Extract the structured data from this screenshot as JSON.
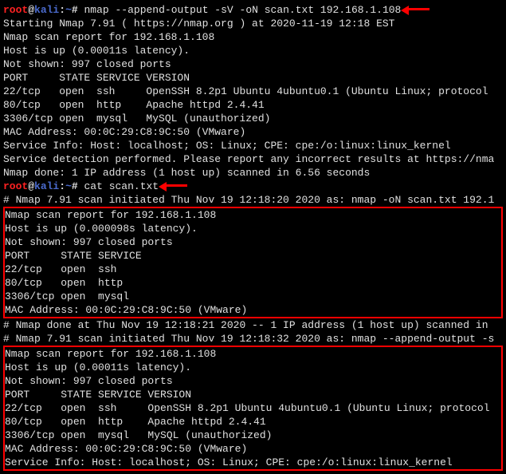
{
  "prompt": {
    "user": "root",
    "sep1": "@",
    "host": "kali",
    "sep2": ":",
    "path": "~",
    "hash": "# "
  },
  "cmd1": "nmap --append-output -sV -oN scan.txt 192.168.1.108",
  "out1": {
    "l1": "Starting Nmap 7.91 ( https://nmap.org ) at 2020-11-19 12:18 EST",
    "l2": "Nmap scan report for 192.168.1.108",
    "l3": "Host is up (0.00011s latency).",
    "l4": "Not shown: 997 closed ports",
    "l5": "PORT     STATE SERVICE VERSION",
    "l6": "22/tcp   open  ssh     OpenSSH 8.2p1 Ubuntu 4ubuntu0.1 (Ubuntu Linux; protocol",
    "l7": "80/tcp   open  http    Apache httpd 2.4.41",
    "l8": "3306/tcp open  mysql   MySQL (unauthorized)",
    "l9": "MAC Address: 00:0C:29:C8:9C:50 (VMware)",
    "l10": "Service Info: Host: localhost; OS: Linux; CPE: cpe:/o:linux:linux_kernel",
    "blank": "",
    "l11": "Service detection performed. Please report any incorrect results at https://nma",
    "l12": "Nmap done: 1 IP address (1 host up) scanned in 6.56 seconds"
  },
  "cmd2": "cat scan.txt",
  "file": {
    "h1": "# Nmap 7.91 scan initiated Thu Nov 19 12:18:20 2020 as: nmap -oN scan.txt 192.1",
    "b1l1": "Nmap scan report for 192.168.1.108",
    "b1l2": "Host is up (0.000098s latency).",
    "b1l3": "Not shown: 997 closed ports",
    "b1l4": "PORT     STATE SERVICE",
    "b1l5": "22/tcp   open  ssh",
    "b1l6": "80/tcp   open  http",
    "b1l7": "3306/tcp open  mysql",
    "b1l8": "MAC Address: 00:0C:29:C8:9C:50 (VMware)",
    "m1": "",
    "m2": "# Nmap done at Thu Nov 19 12:18:21 2020 -- 1 IP address (1 host up) scanned in ",
    "m3": "# Nmap 7.91 scan initiated Thu Nov 19 12:18:32 2020 as: nmap --append-output -s",
    "b2l1": "Nmap scan report for 192.168.1.108",
    "b2l2": "Host is up (0.00011s latency).",
    "b2l3": "Not shown: 997 closed ports",
    "b2l4": "PORT     STATE SERVICE VERSION",
    "b2l5": "22/tcp   open  ssh     OpenSSH 8.2p1 Ubuntu 4ubuntu0.1 (Ubuntu Linux; protocol",
    "b2l6": "80/tcp   open  http    Apache httpd 2.4.41",
    "b2l7": "3306/tcp open  mysql   MySQL (unauthorized)",
    "b2l8": "MAC Address: 00:0C:29:C8:9C:50 (VMware)",
    "b2l9": "Service Info: Host: localhost; OS: Linux; CPE: cpe:/o:linux:linux_kernel"
  }
}
